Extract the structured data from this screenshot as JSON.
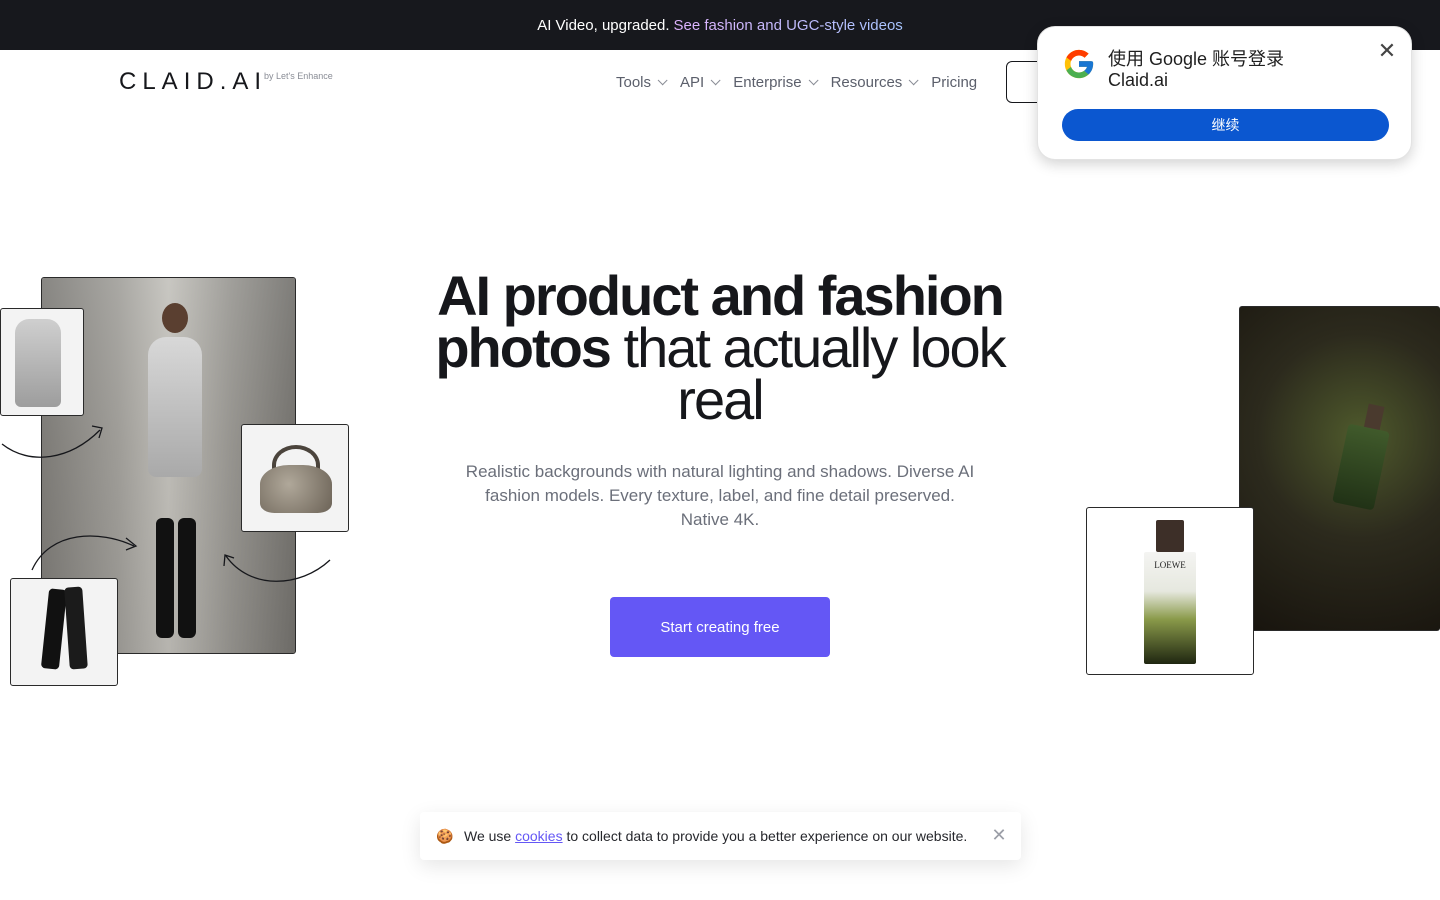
{
  "announcement": {
    "text": "AI Video, upgraded.",
    "link": "See fashion and UGC-style videos"
  },
  "nav": {
    "logo": "CLAID.AI",
    "logo_sub": "by Let's Enhance",
    "menu": [
      {
        "label": "Tools",
        "has_dropdown": true
      },
      {
        "label": "API",
        "has_dropdown": true
      },
      {
        "label": "Enterprise",
        "has_dropdown": true
      },
      {
        "label": "Resources",
        "has_dropdown": true
      },
      {
        "label": "Pricing",
        "has_dropdown": false
      }
    ]
  },
  "hero": {
    "title_bold": "AI product and fashion photos",
    "title_light": "that actually look real",
    "description": "Realistic backgrounds with natural lighting and shadows. Diverse AI fashion models. Every texture, label, and fine detail preserved. Native 4K.",
    "cta": "Start creating free"
  },
  "images": {
    "perfume_brand": "LOEWE"
  },
  "google_popup": {
    "title": "使用 Google 账号登录",
    "site": "Claid.ai",
    "continue_label": "继续",
    "icon": "google-logo-icon"
  },
  "cookie_banner": {
    "emoji": "🍪",
    "prefix": "We use",
    "link": "cookies",
    "suffix": "to collect data to provide you a better experience on our website."
  },
  "colors": {
    "accent": "#6457f5",
    "topbar": "#17181d",
    "google_blue": "#0b57d0"
  }
}
